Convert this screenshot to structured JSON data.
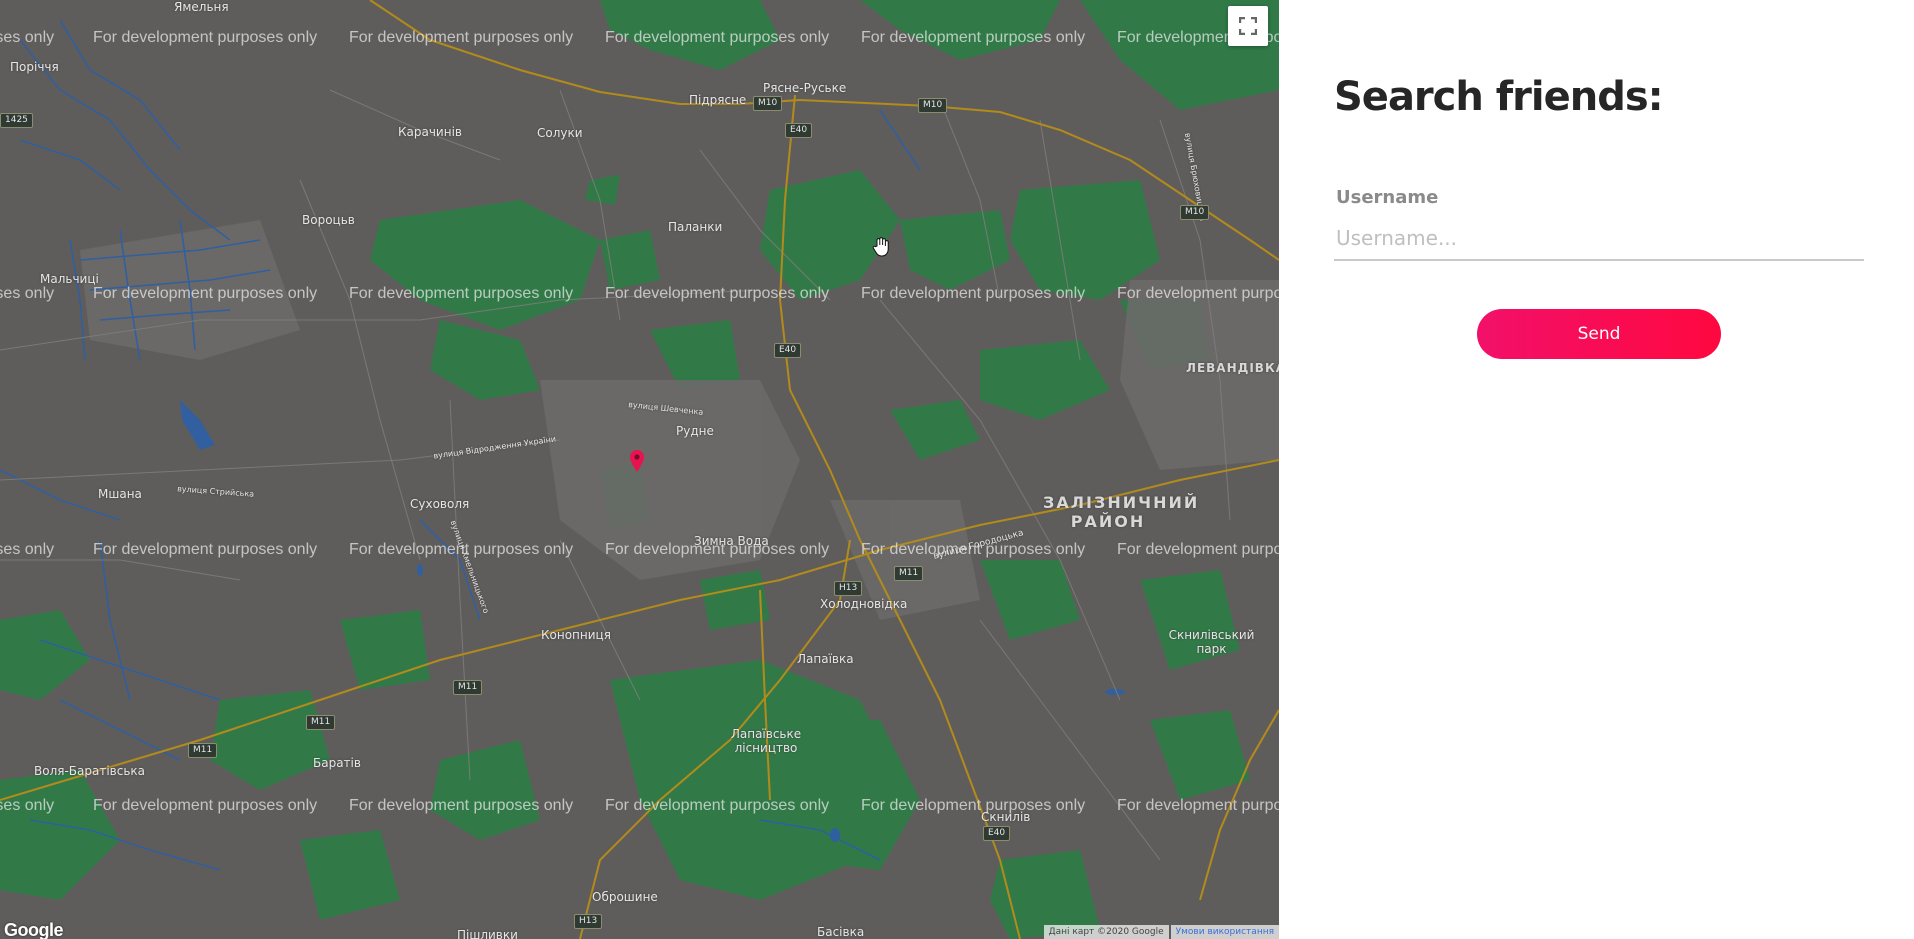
{
  "map": {
    "watermark_text": "For development purposes only",
    "fullscreen_icon": "fullscreen-icon",
    "pin_icon": "map-pin-icon",
    "cursor_icon": "hand-cursor-icon",
    "pin_color": "#e8134f",
    "google_logo": "Google",
    "attribution": {
      "data": "Дані карт ©2020 Google",
      "terms": "Умови використання"
    },
    "places": [
      "Ямельня",
      "Поріччя",
      "Підрясне",
      "Рясне-Руське",
      "Карачинів",
      "Солуки",
      "Вороцьв",
      "Паланки",
      "Мальчиці",
      "Рудне",
      "Мшана",
      "Суховоля",
      "Зимна Вода",
      "Холодновідка",
      "Конопниця",
      "Лапаївка",
      "Лапаївське лісництво",
      "Баратів",
      "Воля-Баратівська",
      "Оброшине",
      "Скнилівський парк",
      "Скнилів",
      "Басівка",
      "Пішливки",
      "ЛЕВАНДІВКА",
      "ЗАЛІЗНИЧНИЙ РАЙОН"
    ],
    "streets": [
      "вулиця Шевченка",
      "вулиця Відродження України",
      "вулиця Стрийська",
      "вулиця Городоцька",
      "вулиця Хмельницького",
      "вулиця Брюховицька"
    ],
    "shields": [
      "M10",
      "E40",
      "M11",
      "H13",
      "1425"
    ]
  },
  "panel": {
    "title": "Search friends:",
    "username_label": "Username",
    "username_placeholder": "Username...",
    "username_value": "",
    "send_label": "Send",
    "send_gradient": [
      "#f2106a",
      "#ff0840"
    ]
  }
}
